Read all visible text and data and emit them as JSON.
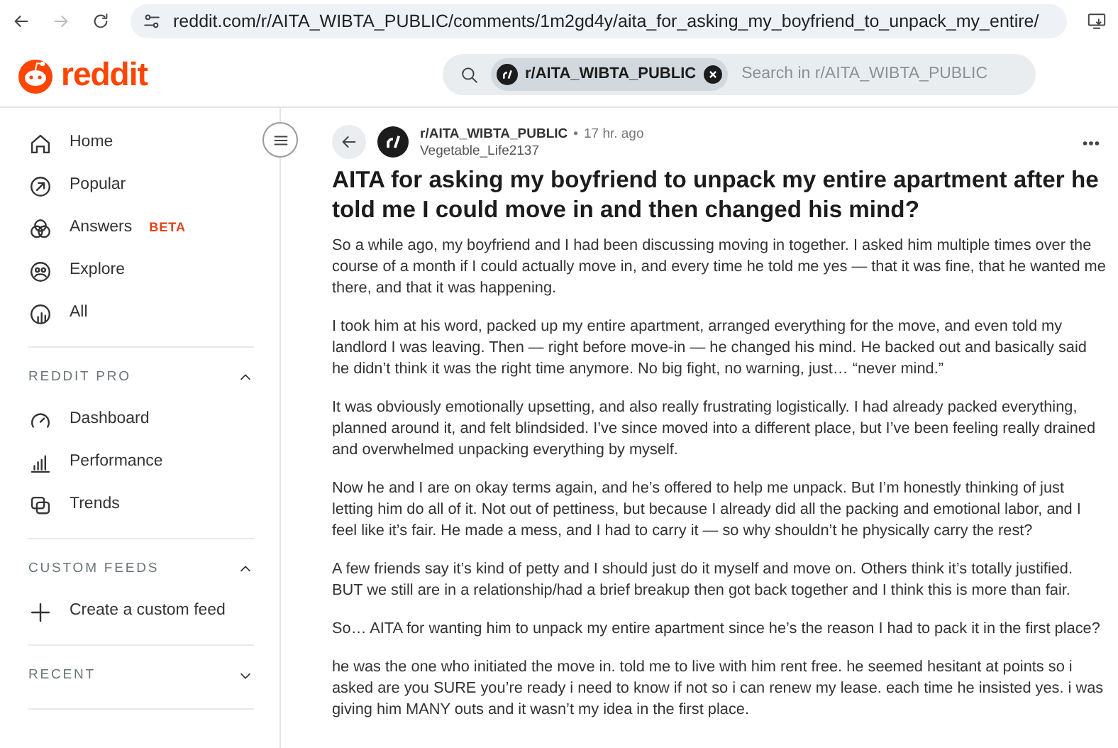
{
  "browser": {
    "nav": [
      {
        "kind": "back",
        "disabled": false
      },
      {
        "kind": "forward",
        "disabled": true
      },
      {
        "kind": "reload",
        "disabled": false
      }
    ],
    "url": "reddit.com/r/AITA_WIBTA_PUBLIC/comments/1m2gd4y/aita_for_asking_my_boyfriend_to_unpack_my_entire/"
  },
  "header": {
    "logo_text": "reddit",
    "search": {
      "chip": "r/AITA_WIBTA_PUBLIC",
      "placeholder": "Search in r/AITA_WIBTA_PUBLIC"
    }
  },
  "sidebar": {
    "items": [
      {
        "kind": "home",
        "label": "Home"
      },
      {
        "kind": "popular",
        "label": "Popular"
      },
      {
        "kind": "answers",
        "label": "Answers",
        "badge": "BETA"
      },
      {
        "kind": "explore",
        "label": "Explore"
      },
      {
        "kind": "all",
        "label": "All"
      }
    ],
    "sections": [
      {
        "title": "REDDIT PRO",
        "expanded": true,
        "items": [
          {
            "kind": "dashboard",
            "label": "Dashboard"
          },
          {
            "kind": "performance",
            "label": "Performance"
          },
          {
            "kind": "trends",
            "label": "Trends"
          }
        ]
      },
      {
        "title": "CUSTOM FEEDS",
        "expanded": true,
        "items": [
          {
            "kind": "plus",
            "label": "Create a custom feed"
          }
        ]
      },
      {
        "title": "RECENT",
        "expanded": false
      }
    ]
  },
  "post": {
    "subreddit": "r/AITA_WIBTA_PUBLIC",
    "separator": "•",
    "time": "17 hr. ago",
    "author": "Vegetable_Life2137",
    "title": "AITA for asking my boyfriend to unpack my entire apartment after he told me I could move in and then changed his mind?",
    "paragraphs": [
      "So a while ago, my boyfriend and I had been discussing moving in together. I asked him multiple times over the course of a month if I could actually move in, and every time he told me yes — that it was fine, that he wanted me there, and that it was happening.",
      "I took him at his word, packed up my entire apartment, arranged everything for the move, and even told my landlord I was leaving. Then — right before move-in — he changed his mind. He backed out and basically said he didn’t think it was the right time anymore. No big fight, no warning, just… “never mind.”",
      "It was obviously emotionally upsetting, and also really frustrating logistically. I had already packed everything, planned around it, and felt blindsided. I’ve since moved into a different place, but I’ve been feeling really drained and overwhelmed unpacking everything by myself.",
      "Now he and I are on okay terms again, and he’s offered to help me unpack. But I’m honestly thinking of just letting him do all of it. Not out of pettiness, but because I already did all the packing and emotional labor, and I feel like it’s fair. He made a mess, and I had to carry it — so why shouldn’t he physically carry the rest?",
      "A few friends say it’s kind of petty and I should just do it myself and move on. Others think it’s totally justified. BUT we still are in a relationship/had a brief breakup then got back together and I think this is more than fair.",
      "So… AITA for wanting him to unpack my entire apartment since he’s the reason I had to pack it in the first place?",
      "he was the one who initiated the move in. told me to live with him rent free. he seemed hesitant at points so i asked are you SURE you’re ready i need to know if not so i can renew my lease. each time he insisted yes. i was giving him MANY outs and it wasn’t my idea in the first place."
    ]
  }
}
